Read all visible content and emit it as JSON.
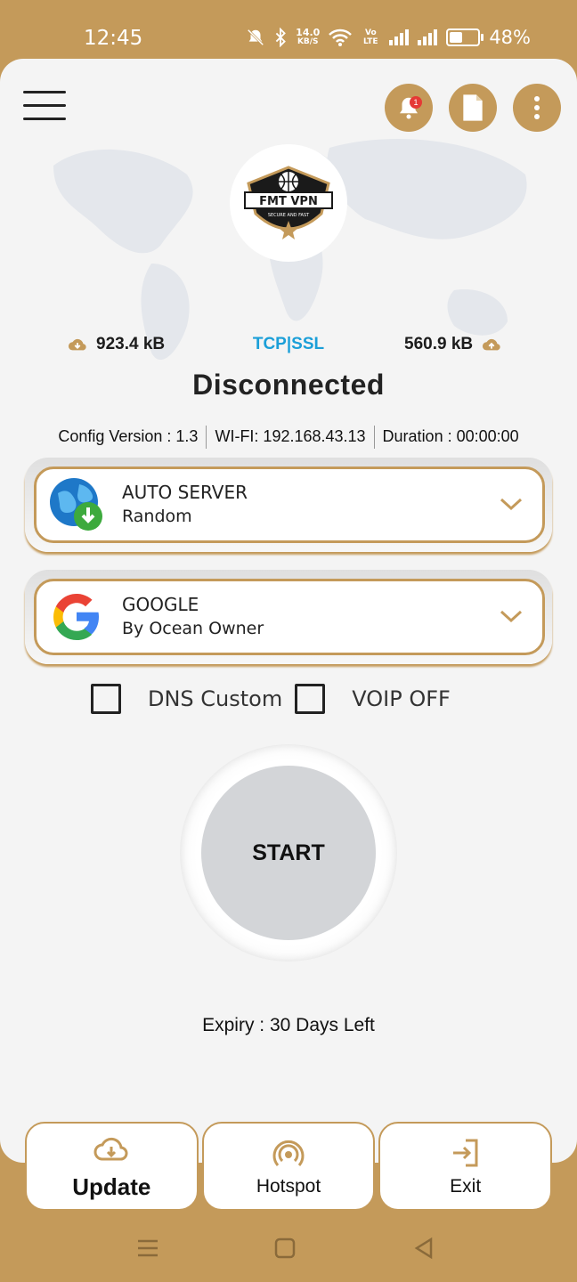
{
  "status_bar": {
    "time": "12:45",
    "net_speed_value": "14.0",
    "net_speed_unit": "KB/S",
    "volte": "Vo LTE",
    "battery": "48%",
    "battery_fraction": 0.48
  },
  "header": {
    "notification_count": "1",
    "logo_text": "FMT VPN",
    "logo_tagline": "SECURE AND FAST"
  },
  "stats": {
    "download": "923.4 kB",
    "protocol": "TCP|SSL",
    "upload": "560.9 kB"
  },
  "connection": {
    "status": "Disconnected",
    "config_version": "Config Version : 1.3",
    "wifi": "WI-FI: 192.168.43.13",
    "duration": "Duration : 00:00:00"
  },
  "server": {
    "title": "AUTO SERVER",
    "subtitle": "Random"
  },
  "payload": {
    "title": "GOOGLE",
    "subtitle": "By Ocean Owner"
  },
  "options": {
    "dns_label": "DNS Custom",
    "voip_label": "VOIP OFF"
  },
  "start_label": "START",
  "expiry": "Expiry : 30 Days Left",
  "bottom": {
    "update": "Update",
    "hotspot": "Hotspot",
    "exit": "Exit"
  },
  "colors": {
    "accent": "#C49A5A",
    "protocol": "#1B9FD8",
    "background": "#F4F4F4"
  }
}
